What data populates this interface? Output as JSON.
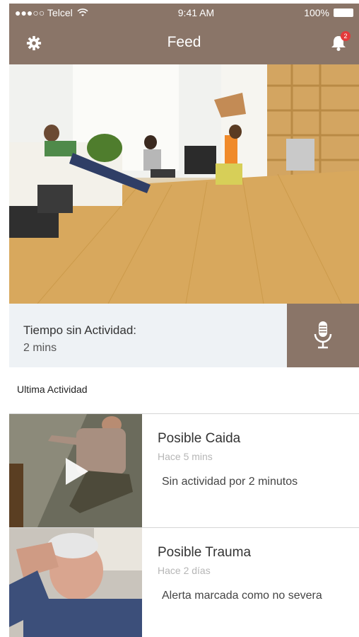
{
  "status_bar": {
    "carrier": "●●●○○ Telcel",
    "time": "9:41 AM",
    "battery": "100%"
  },
  "nav": {
    "title": "Feed",
    "notification_count": "2",
    "left_icon": "gear-icon",
    "right_icon": "bell-icon"
  },
  "activity": {
    "label": "Tiempo sin Actividad:",
    "value": "2 mins",
    "mic_icon": "microphone-icon"
  },
  "section": {
    "title": "Ultima Actividad"
  },
  "events": [
    {
      "title": "Posible Caida",
      "time": "Hace 5 mins",
      "description": "Sin actividad por 2 minutos",
      "has_video": true
    },
    {
      "title": "Posible Trauma",
      "time": "Hace 2 días",
      "description": "Alerta marcada como no severa",
      "has_video": false
    }
  ],
  "colors": {
    "brand": "#8a7568",
    "panel": "#eef2f5",
    "badge": "#e23b3b"
  }
}
